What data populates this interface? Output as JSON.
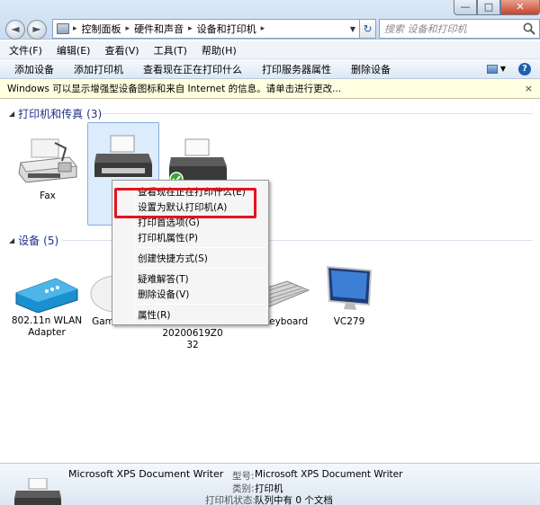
{
  "window": {
    "min_label": "—",
    "max_label": "□",
    "close_label": "✕"
  },
  "addressbar": {
    "back_label": "◄",
    "forward_label": "►",
    "breadcrumb": [
      "控制面板",
      "硬件和声音",
      "设备和打印机"
    ],
    "search_placeholder": "搜索 设备和打印机"
  },
  "menubar": {
    "items": [
      "文件(F)",
      "编辑(E)",
      "查看(V)",
      "工具(T)",
      "帮助(H)"
    ]
  },
  "commandbar": {
    "items": [
      "添加设备",
      "添加打印机",
      "查看现在正在打印什么",
      "打印服务器属性",
      "删除设备"
    ]
  },
  "infobar": {
    "message": "Windows 可以显示增强型设备图标和来自 Internet 的信息。请单击进行更改...",
    "close_label": "×"
  },
  "printers_group": {
    "title": "打印机和传真",
    "count": "(3)",
    "items": [
      {
        "label": "Fax",
        "icon": "fax-icon"
      },
      {
        "label": "Microsoft XPS Document Writer",
        "label_visible": [
          "Micr",
          "Doc",
          "W"
        ],
        "icon": "printer-icon",
        "selected": true
      },
      {
        "label": "",
        "icon": "printer-icon"
      }
    ]
  },
  "devices_group": {
    "title": "设备",
    "count": "(5)",
    "items": [
      {
        "label_lines": [
          "802.11n  WLAN",
          "Adapter"
        ],
        "icon": "router-icon"
      },
      {
        "label_lines": [
          "Game mouse"
        ],
        "icon": "mouse-icon"
      },
      {
        "label_lines": [
          "PC-20200619Z0",
          "32"
        ],
        "icon": "computer-icon"
      },
      {
        "label_lines": [
          "USB Keyboard"
        ],
        "icon": "keyboard-icon"
      },
      {
        "label_lines": [
          "VC279"
        ],
        "icon": "monitor-icon"
      }
    ]
  },
  "context_menu": {
    "items": [
      "查看现在正在打印什么(E)",
      "设置为默认打印机(A)",
      "打印首选项(G)",
      "打印机属性(P)",
      "创建快捷方式(S)",
      "疑难解答(T)",
      "删除设备(V)",
      "属性(R)"
    ],
    "highlighted_index": 1,
    "highlight_color": "#e3141c"
  },
  "details": {
    "name": "Microsoft XPS Document Writer",
    "model_key": "型号:",
    "model_val": "Microsoft XPS Document Writer",
    "category_key": "类别:",
    "category_val": "打印机",
    "status_key": "打印机状态:",
    "status_val": "队列中有 0 个文档"
  }
}
